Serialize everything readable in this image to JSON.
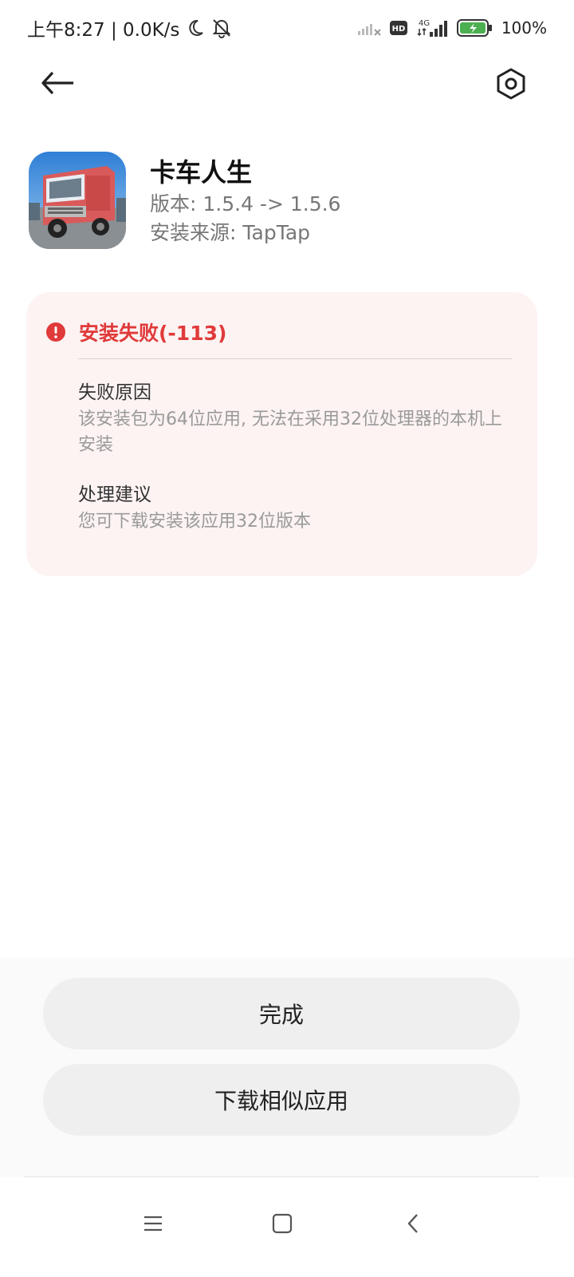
{
  "status_bar": {
    "time_text": "上午8:27 | 0.0K/s",
    "battery_text": "100%",
    "network_label": "4G",
    "hd_label": "HD",
    "icons": [
      "moon-icon",
      "bell-muted-icon",
      "signal-weak-icon",
      "hd-icon",
      "signal-4g-icon",
      "battery-charging-icon"
    ]
  },
  "header": {
    "back_icon": "arrow-left-icon",
    "settings_icon": "gear-hexagon-icon"
  },
  "app": {
    "name": "卡车人生",
    "version": "版本: 1.5.4 -> 1.5.6",
    "source": "安装来源: TapTap",
    "icon": "truck-app-icon"
  },
  "error": {
    "title": "安装失败(-113)",
    "icon": "error-exclamation-icon",
    "color": "#e03a3a",
    "reason_title": "失败原因",
    "reason_text": "该安装包为64位应用, 无法在采用32位处理器的本机上安装",
    "suggestion_title": "处理建议",
    "suggestion_text": "您可下载安装该应用32位版本"
  },
  "buttons": {
    "done": "完成",
    "download_similar": "下载相似应用"
  },
  "nav": {
    "icons": [
      "menu-icon",
      "home-square-icon",
      "back-chevron-icon"
    ]
  }
}
